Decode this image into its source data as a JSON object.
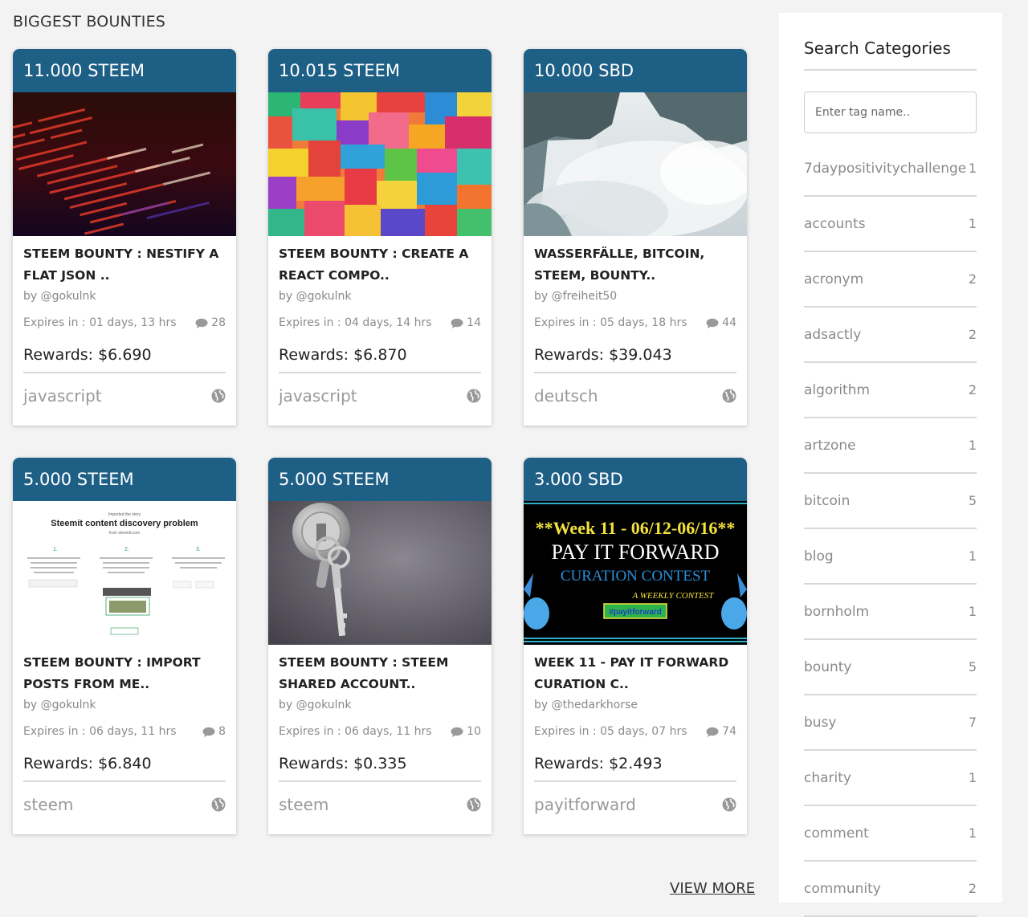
{
  "section_title": "BIGGEST BOUNTIES",
  "view_more": "VIEW MORE",
  "bounties": [
    {
      "amount": "11.000 STEEM",
      "title": "STEEM BOUNTY : NESTIFY A FLAT JSON ..",
      "author": "by @gokulnk",
      "expires": "Expires in : 01 days, 13 hrs",
      "comments": "28",
      "reward": "Rewards: $6.690",
      "tag": "javascript",
      "image": "code-screen"
    },
    {
      "amount": "10.015 STEEM",
      "title": "STEEM BOUNTY : CREATE A REACT COMPO..",
      "author": "by @gokulnk",
      "expires": "Expires in : 04 days, 14 hrs",
      "comments": "14",
      "reward": "Rewards: $6.870",
      "tag": "javascript",
      "image": "color-blocks"
    },
    {
      "amount": "10.000 SBD",
      "title": "WASSERFÄLLE, BITCOIN, STEEM, BOUNTY..",
      "author": "by @freiheit50",
      "expires": "Expires in : 05 days, 18 hrs",
      "comments": "44",
      "reward": "Rewards: $39.043",
      "tag": "deutsch",
      "image": "waterfall"
    },
    {
      "amount": "5.000 STEEM",
      "title": "STEEM BOUNTY : IMPORT POSTS FROM ME..",
      "author": "by @gokulnk",
      "expires": "Expires in : 06 days, 11 hrs",
      "comments": "8",
      "reward": "Rewards: $6.840",
      "tag": "steem",
      "image": "discovery-diagram"
    },
    {
      "amount": "5.000 STEEM",
      "title": "STEEM BOUNTY : STEEM SHARED ACCOUNT..",
      "author": "by @gokulnk",
      "expires": "Expires in : 06 days, 11 hrs",
      "comments": "10",
      "reward": "Rewards: $0.335",
      "tag": "steem",
      "image": "keys"
    },
    {
      "amount": "3.000 SBD",
      "title": "WEEK 11 - PAY IT FORWARD CURATION C..",
      "author": "by @thedarkhorse",
      "expires": "Expires in : 05 days, 07 hrs",
      "comments": "74",
      "reward": "Rewards: $2.493",
      "tag": "payitforward",
      "image": "pay-it-forward-banner"
    }
  ],
  "diagram_text": {
    "small_top": "Imported the story",
    "heading": "Steemit content discovery problem",
    "small_sub": "from steemit.com",
    "steps": [
      "1.",
      "2.",
      "3."
    ]
  },
  "banner_text": {
    "line1": "**Week 11 - 06/12-06/16**",
    "line2": "PAY IT FORWARD",
    "line3": "CURATION CONTEST",
    "line4": "A WEEKLY CONTEST",
    "line5": "#payitforward"
  },
  "sidebar": {
    "title": "Search Categories",
    "search_placeholder": "Enter tag name..",
    "categories": [
      {
        "name": "7daypositivitychallenge",
        "count": "1"
      },
      {
        "name": "accounts",
        "count": "1"
      },
      {
        "name": "acronym",
        "count": "2"
      },
      {
        "name": "adsactly",
        "count": "2"
      },
      {
        "name": "algorithm",
        "count": "2"
      },
      {
        "name": "artzone",
        "count": "1"
      },
      {
        "name": "bitcoin",
        "count": "5"
      },
      {
        "name": "blog",
        "count": "1"
      },
      {
        "name": "bornholm",
        "count": "1"
      },
      {
        "name": "bounty",
        "count": "5"
      },
      {
        "name": "busy",
        "count": "7"
      },
      {
        "name": "charity",
        "count": "1"
      },
      {
        "name": "comment",
        "count": "1"
      },
      {
        "name": "community",
        "count": "2"
      }
    ]
  },
  "colors": {
    "card_header": "#1e5f86",
    "page_bg": "#f3f3f3",
    "muted_text": "#8a8a8a"
  }
}
